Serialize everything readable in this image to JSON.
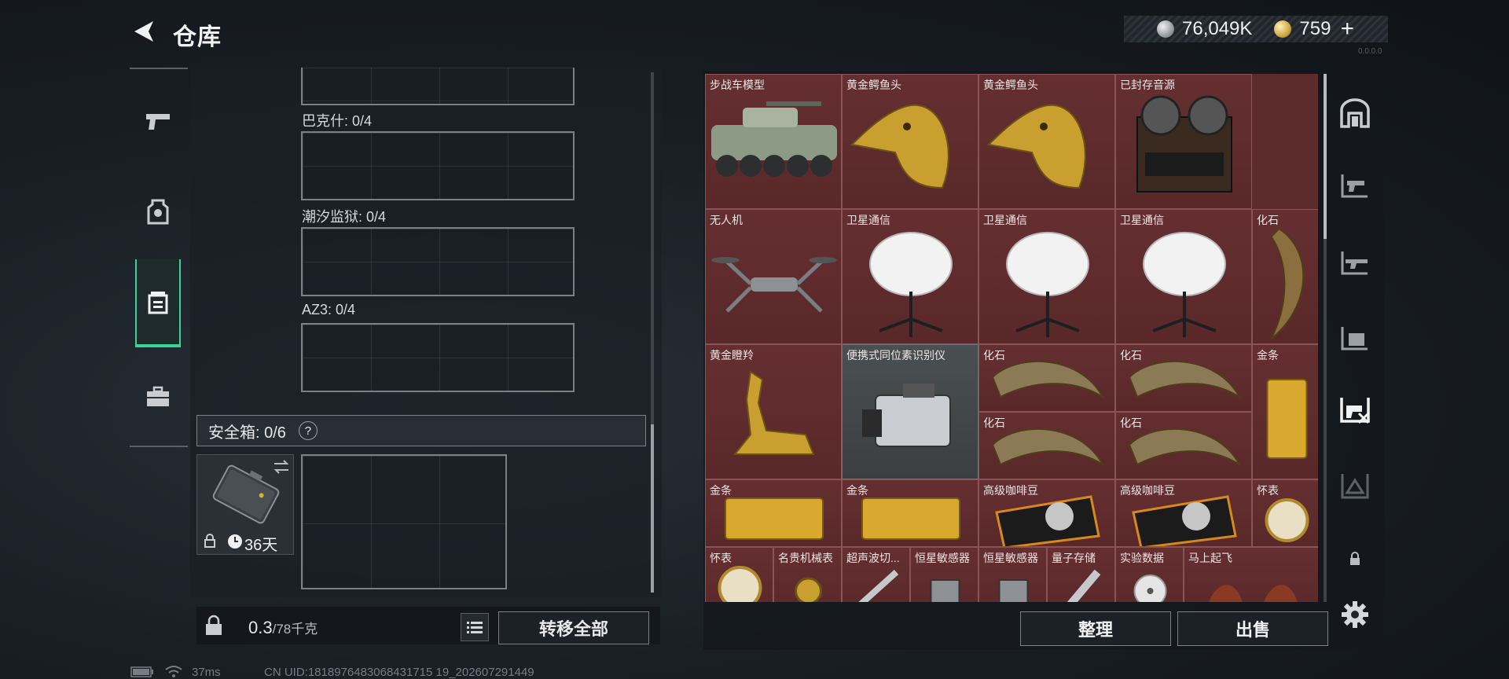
{
  "header": {
    "title": "仓库",
    "version": "0.0.0.0"
  },
  "currency": {
    "silver_value": "76,049K",
    "gold_value": "759",
    "add_label": "+"
  },
  "left_tabs": [
    "weapons",
    "equipment",
    "backpack",
    "cases"
  ],
  "stash": {
    "sections": [
      {
        "label": "巴克什: 0/4"
      },
      {
        "label": "潮汐监狱: 0/4"
      },
      {
        "label": "AZ3: 0/4"
      }
    ],
    "safebox_label": "安全箱:  0/6",
    "safebox_help": "?",
    "safebox_days": "36天",
    "weight_value": "0.3",
    "weight_max": "/78千克",
    "transfer_all": "转移全部"
  },
  "status": {
    "ping": "37ms",
    "uid": "CN UID:1818976483068431715 19_202607291449"
  },
  "inventory": {
    "items": [
      {
        "name": "步战车模型",
        "icon": "apc-model"
      },
      {
        "name": "黄金鳄鱼头",
        "icon": "gold-croc-head"
      },
      {
        "name": "黄金鳄鱼头",
        "icon": "gold-croc-head"
      },
      {
        "name": "已封存音源",
        "icon": "reel-recorder"
      },
      {
        "name": "无人机",
        "icon": "drone"
      },
      {
        "name": "卫星通信",
        "icon": "satellite-dish"
      },
      {
        "name": "卫星通信",
        "icon": "satellite-dish"
      },
      {
        "name": "卫星通信",
        "icon": "satellite-dish"
      },
      {
        "name": "化石",
        "icon": "fossil-claw"
      },
      {
        "name": "黄金瞪羚",
        "icon": "gold-gazelle"
      },
      {
        "name": "便携式同位素识别仪",
        "icon": "isotope-scanner"
      },
      {
        "name": "化石",
        "icon": "fossil-claw"
      },
      {
        "name": "化石",
        "icon": "fossil-claw"
      },
      {
        "name": "金条",
        "icon": "gold-bar"
      },
      {
        "name": "化石",
        "icon": "fossil-claw"
      },
      {
        "name": "化石",
        "icon": "fossil-claw"
      },
      {
        "name": "金条",
        "icon": "gold-bar"
      },
      {
        "name": "金条",
        "icon": "gold-bar"
      },
      {
        "name": "高级咖啡豆",
        "icon": "coffee-beans"
      },
      {
        "name": "高级咖啡豆",
        "icon": "coffee-beans"
      },
      {
        "name": "怀表",
        "icon": "pocket-watch"
      },
      {
        "name": "怀表",
        "icon": "pocket-watch"
      },
      {
        "name": "名贵机械表",
        "icon": "wrist-watch"
      },
      {
        "name": "超声波切...",
        "icon": "ultrasonic-cutter"
      },
      {
        "name": "恒星敏感器",
        "icon": "star-sensor"
      },
      {
        "name": "恒星敏感器",
        "icon": "star-sensor"
      },
      {
        "name": "量子存储",
        "icon": "quantum-storage"
      },
      {
        "name": "实验数据",
        "icon": "data-disc"
      },
      {
        "name": "马上起飞",
        "icon": "horse-statue"
      }
    ],
    "sort_label": "整理",
    "sell_label": "出售"
  }
}
